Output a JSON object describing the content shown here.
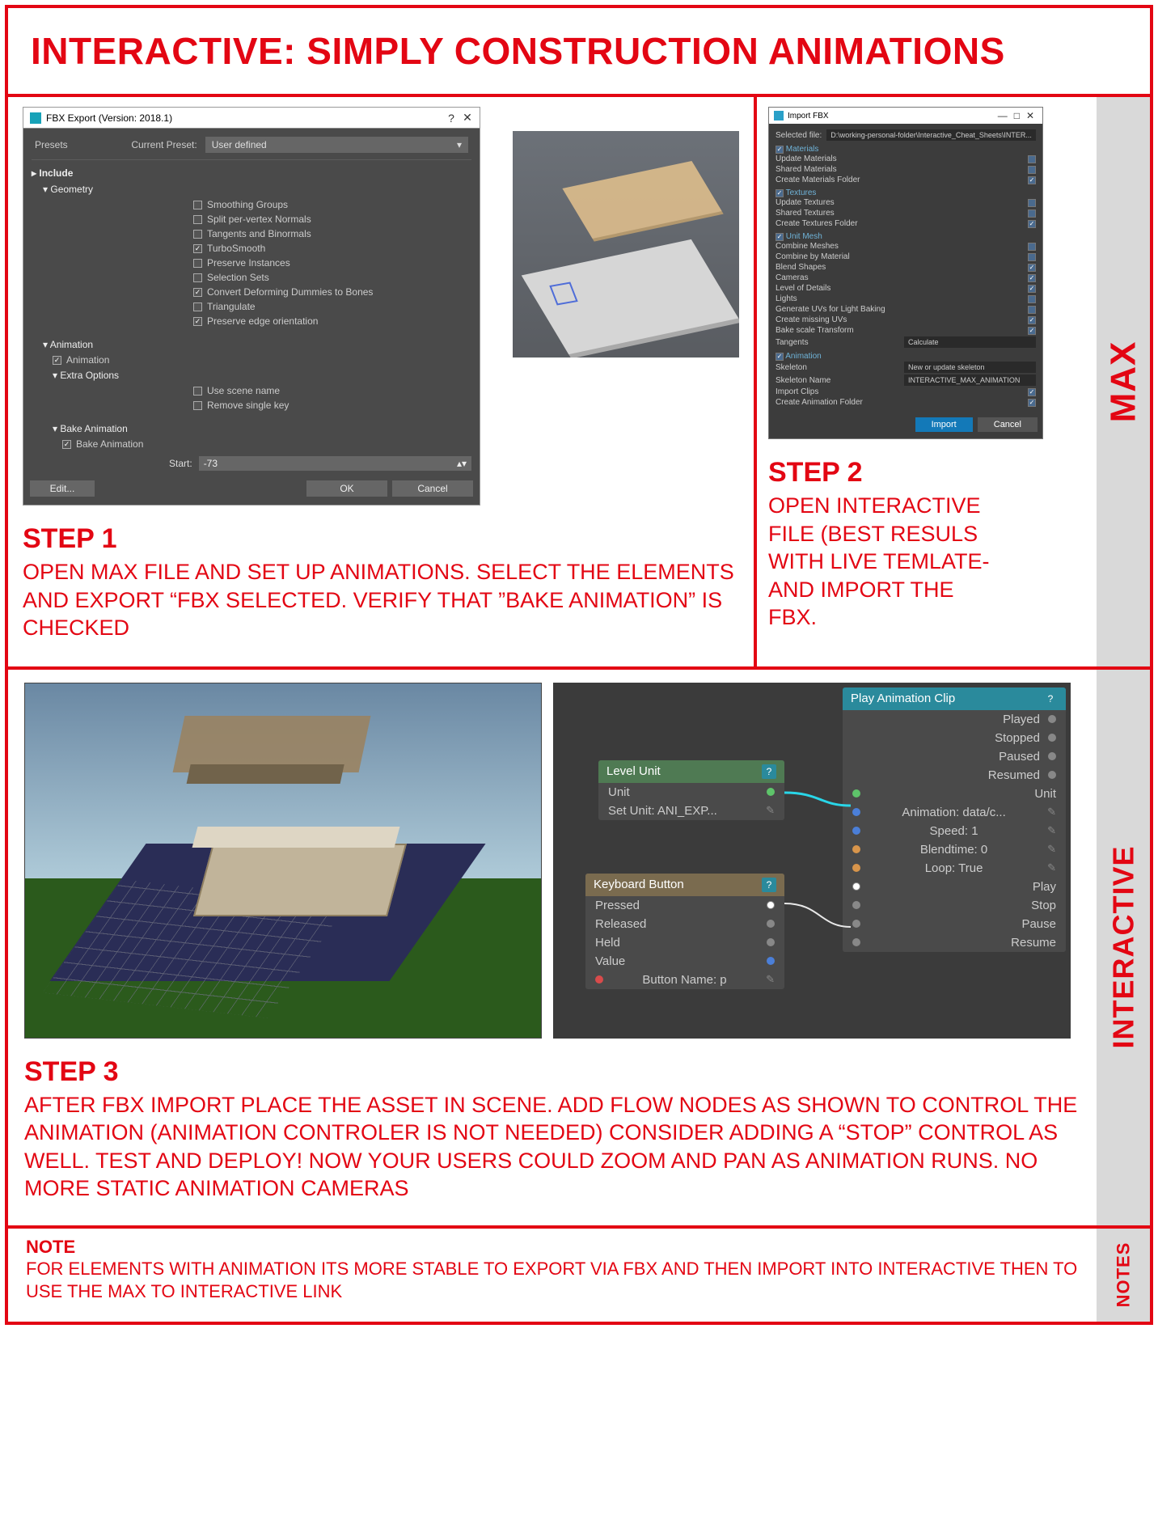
{
  "header": {
    "title": "INTERACTIVE: SIMPLY CONSTRUCTION ANIMATIONS"
  },
  "tabs": {
    "max": "MAX",
    "interactive": "INTERACTIVE",
    "notes": "NOTES"
  },
  "fbx": {
    "window_title": "FBX Export (Version: 2018.1)",
    "presets_label": "Presets",
    "current_preset_label": "Current Preset:",
    "current_preset_value": "User defined",
    "include": "Include",
    "geometry": "Geometry",
    "opts": {
      "smoothing": "Smoothing Groups",
      "split": "Split per-vertex Normals",
      "tangents": "Tangents and Binormals",
      "turbo": "TurboSmooth",
      "preserve_inst": "Preserve Instances",
      "selsets": "Selection Sets",
      "dummies": "Convert Deforming Dummies to Bones",
      "triangulate": "Triangulate",
      "edgeorient": "Preserve edge orientation"
    },
    "animation_hdr": "Animation",
    "animation_chk": "Animation",
    "extra_hdr": "Extra Options",
    "use_scene": "Use scene name",
    "remove_single": "Remove single key",
    "bake_hdr": "Bake Animation",
    "bake_chk": "Bake Animation",
    "start_label": "Start:",
    "start_value": "-73",
    "edit_btn": "Edit...",
    "ok_btn": "OK",
    "cancel_btn": "Cancel"
  },
  "importfbx": {
    "title": "Import FBX",
    "selected_file_label": "Selected file:",
    "selected_file_value": "D:\\working-personal-folder\\Interactive_Cheat_Sheets\\INTER...",
    "materials": "Materials",
    "update_materials": "Update Materials",
    "shared_materials": "Shared Materials",
    "create_materials_folder": "Create Materials Folder",
    "textures": "Textures",
    "update_textures": "Update Textures",
    "shared_textures": "Shared Textures",
    "create_textures_folder": "Create Textures Folder",
    "unit_mesh": "Unit Mesh",
    "combine_meshes": "Combine Meshes",
    "combine_by_material": "Combine by Material",
    "blend_shapes": "Blend Shapes",
    "cameras": "Cameras",
    "lod": "Level of Details",
    "lights": "Lights",
    "generate_uvs": "Generate UVs for Light Baking",
    "create_missing_uvs": "Create missing UVs",
    "bake_scale": "Bake scale Transform",
    "tangents_label": "Tangents",
    "tangents_value": "Calculate",
    "animation": "Animation",
    "skeleton_label": "Skeleton",
    "skeleton_value": "New or update skeleton",
    "skeleton_name_label": "Skeleton Name",
    "skeleton_name_value": "INTERACTIVE_MAX_ANIMATION",
    "import_clips": "Import Clips",
    "create_anim_folder": "Create Animation Folder",
    "import_btn": "Import",
    "cancel_btn": "Cancel"
  },
  "step1": {
    "title": "STEP 1",
    "body": "OPEN MAX FILE AND SET UP ANIMATIONS. SELECT THE ELEMENTS AND EXPORT “FBX SELECTED. VERIFY THAT ”BAKE ANIMATION” IS CHECKED"
  },
  "step2": {
    "title": "STEP 2",
    "body": "OPEN INTERACTIVE FILE (BEST RESULS WITH LIVE TEMLATE- AND IMPORT THE FBX."
  },
  "step3": {
    "title": "STEP 3",
    "body": "AFTER FBX IMPORT PLACE THE ASSET IN SCENE. ADD FLOW NODES AS SHOWN TO CONTROL THE ANIMATION (ANIMATION CONTROLER IS NOT NEEDED) CONSIDER ADDING A “STOP” CONTROL AS WELL. TEST AND DEPLOY! NOW YOUR USERS COULD ZOOM AND PAN AS ANIMATION RUNS. NO MORE STATIC ANIMATION CAMERAS"
  },
  "flow": {
    "level_hdr": "Level Unit",
    "level_unit_out": "Unit",
    "level_setunit": "Set Unit: ANI_EXP...",
    "keyb_hdr": "Keyboard Button",
    "keyb_pressed": "Pressed",
    "keyb_released": "Released",
    "keyb_held": "Held",
    "keyb_value": "Value",
    "keyb_btnname": "Button Name: p",
    "play_hdr": "Play Animation Clip",
    "play_played": "Played",
    "play_stopped": "Stopped",
    "play_paused": "Paused",
    "play_resumed": "Resumed",
    "play_unit": "Unit",
    "play_anim": "Animation: data/c...",
    "play_speed": "Speed: 1",
    "play_blend": "Blendtime: 0",
    "play_loop": "Loop: True",
    "play_play": "Play",
    "play_stop": "Stop",
    "play_pause": "Pause",
    "play_resume": "Resume"
  },
  "notes": {
    "title": "NOTE",
    "body": "FOR ELEMENTS WITH ANIMATION ITS MORE STABLE TO EXPORT VIA FBX AND THEN IMPORT INTO INTERACTIVE THEN TO USE THE MAX TO INTERACTIVE LINK"
  }
}
